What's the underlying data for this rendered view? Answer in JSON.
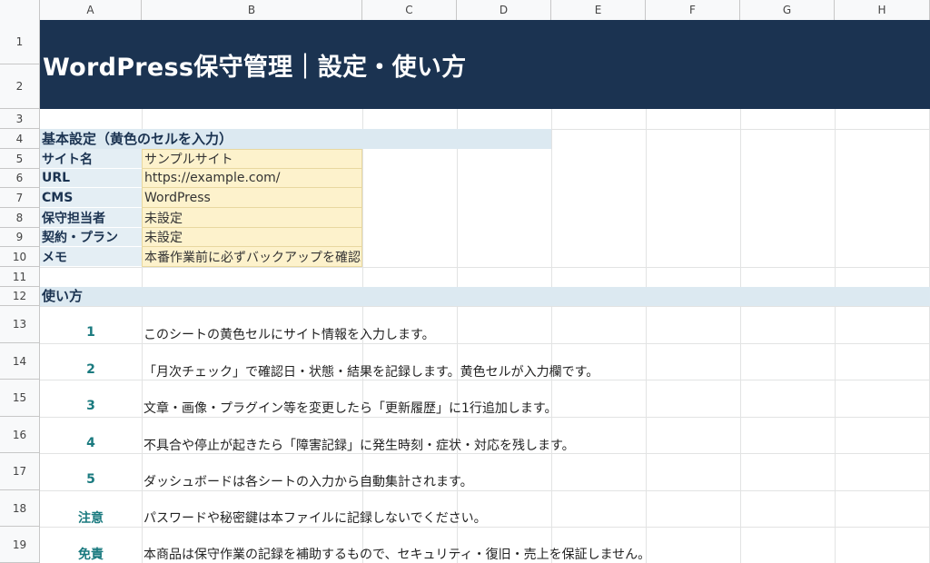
{
  "columns": [
    "A",
    "B",
    "C",
    "D",
    "E",
    "F",
    "G",
    "H"
  ],
  "rows": [
    "1",
    "2",
    "3",
    "4",
    "5",
    "6",
    "7",
    "8",
    "9",
    "10",
    "11",
    "12",
    "13",
    "14",
    "15",
    "16",
    "17",
    "18",
    "19"
  ],
  "title": "WordPress保守管理｜設定・使い方",
  "basic": {
    "heading": "基本設定（黄色のセルを入力）",
    "fields": [
      {
        "label": "サイト名",
        "value": "サンプルサイト"
      },
      {
        "label": "URL",
        "value": "https://example.com/"
      },
      {
        "label": "CMS",
        "value": "WordPress"
      },
      {
        "label": "保守担当者",
        "value": "未設定"
      },
      {
        "label": "契約・プラン",
        "value": "未設定"
      },
      {
        "label": "メモ",
        "value": "本番作業前に必ずバックアップを確認"
      }
    ]
  },
  "usage": {
    "heading": "使い方",
    "steps": [
      {
        "num": "1",
        "text": "このシートの黄色セルにサイト情報を入力します。"
      },
      {
        "num": "2",
        "text": "「月次チェック」で確認日・状態・結果を記録します。黄色セルが入力欄です。"
      },
      {
        "num": "3",
        "text": "文章・画像・プラグイン等を変更したら「更新履歴」に1行追加します。"
      },
      {
        "num": "4",
        "text": "不具合や停止が起きたら「障害記録」に発生時刻・症状・対応を残します。"
      },
      {
        "num": "5",
        "text": "ダッシュボードは各シートの入力から自動集計されます。"
      },
      {
        "num": "注意",
        "text": "パスワードや秘密鍵は本ファイルに記録しないでください。"
      },
      {
        "num": "免責",
        "text": "本商品は保守作業の記録を補助するもので、セキュリティ・復旧・売上を保証しません。"
      }
    ]
  }
}
